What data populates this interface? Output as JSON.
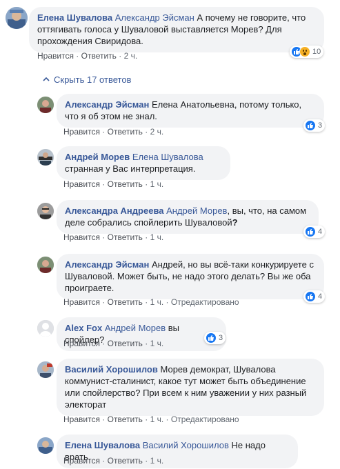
{
  "top_comment": {
    "author": "Елена Шувалова",
    "mention": "Александр Эйсман",
    "text": " А почему не говорите, что оттягивать голоса у Шуваловой выставляется Морев? Для прохождения Свиридова.",
    "like": "Нравится",
    "reply": "Ответить",
    "time": "2 ч.",
    "reactions": "10"
  },
  "hide_replies": "Скрыть 17 ответов",
  "replies": [
    {
      "author": "Александр Эйсман",
      "mention": "",
      "text": "Елена Анатольевна, потому только, что я об этом не знал.",
      "like": "Нравится",
      "reply": "Ответить",
      "time": "2 ч.",
      "edited": "",
      "reactions": "3"
    },
    {
      "author": "Андрей Морев",
      "mention": "Елена Шувалова",
      "text": " странная у Вас интерпретация.",
      "like": "Нравится",
      "reply": "Ответить",
      "time": "1 ч.",
      "edited": "",
      "reactions": ""
    },
    {
      "author": "Александра Андреева",
      "mention": "Андрей Морев",
      "text": ", вы, что, на самом деле собрались спойлерить Шуваловой",
      "text_q": "?",
      "like": "Нравится",
      "reply": "Ответить",
      "time": "1 ч.",
      "edited": "",
      "reactions": "4"
    },
    {
      "author": "Александр Эйсман",
      "mention": "",
      "text": "Андрей, но вы всё-таки конкурируете с Шуваловой. Может быть, не надо этого делать? Вы же оба проиграете.",
      "like": "Нравится",
      "reply": "Ответить",
      "time": "1 ч.",
      "edited": "Отредактировано",
      "reactions": "4"
    },
    {
      "author": "Alex Fox",
      "mention": "Андрей Морев",
      "text": " вы спойлер?",
      "like": "Нравится",
      "reply": "Ответить",
      "time": "1 ч.",
      "edited": "",
      "reactions": "3"
    },
    {
      "author": "Василий Хорошилов",
      "mention": "",
      "text": "Морев демократ, Шувалова коммунист-сталинист, какое тут может быть объединение или спойлерство? При всем к ним уважении у них разный электорат",
      "like": "Нравится",
      "reply": "Ответить",
      "time": "1 ч.",
      "edited": "Отредактировано",
      "reactions": ""
    },
    {
      "author": "Елена Шувалова",
      "mention": "Василий Хорошилов",
      "text": " Не надо врать.",
      "like": "Нравится",
      "reply": "Ответить",
      "time": "1 ч.",
      "edited": "",
      "reactions": ""
    }
  ],
  "separator": " · ",
  "colors": {
    "link": "#385898",
    "bubble": "#f2f3f5",
    "like": "#1877f2",
    "wow": "#f7b125"
  }
}
